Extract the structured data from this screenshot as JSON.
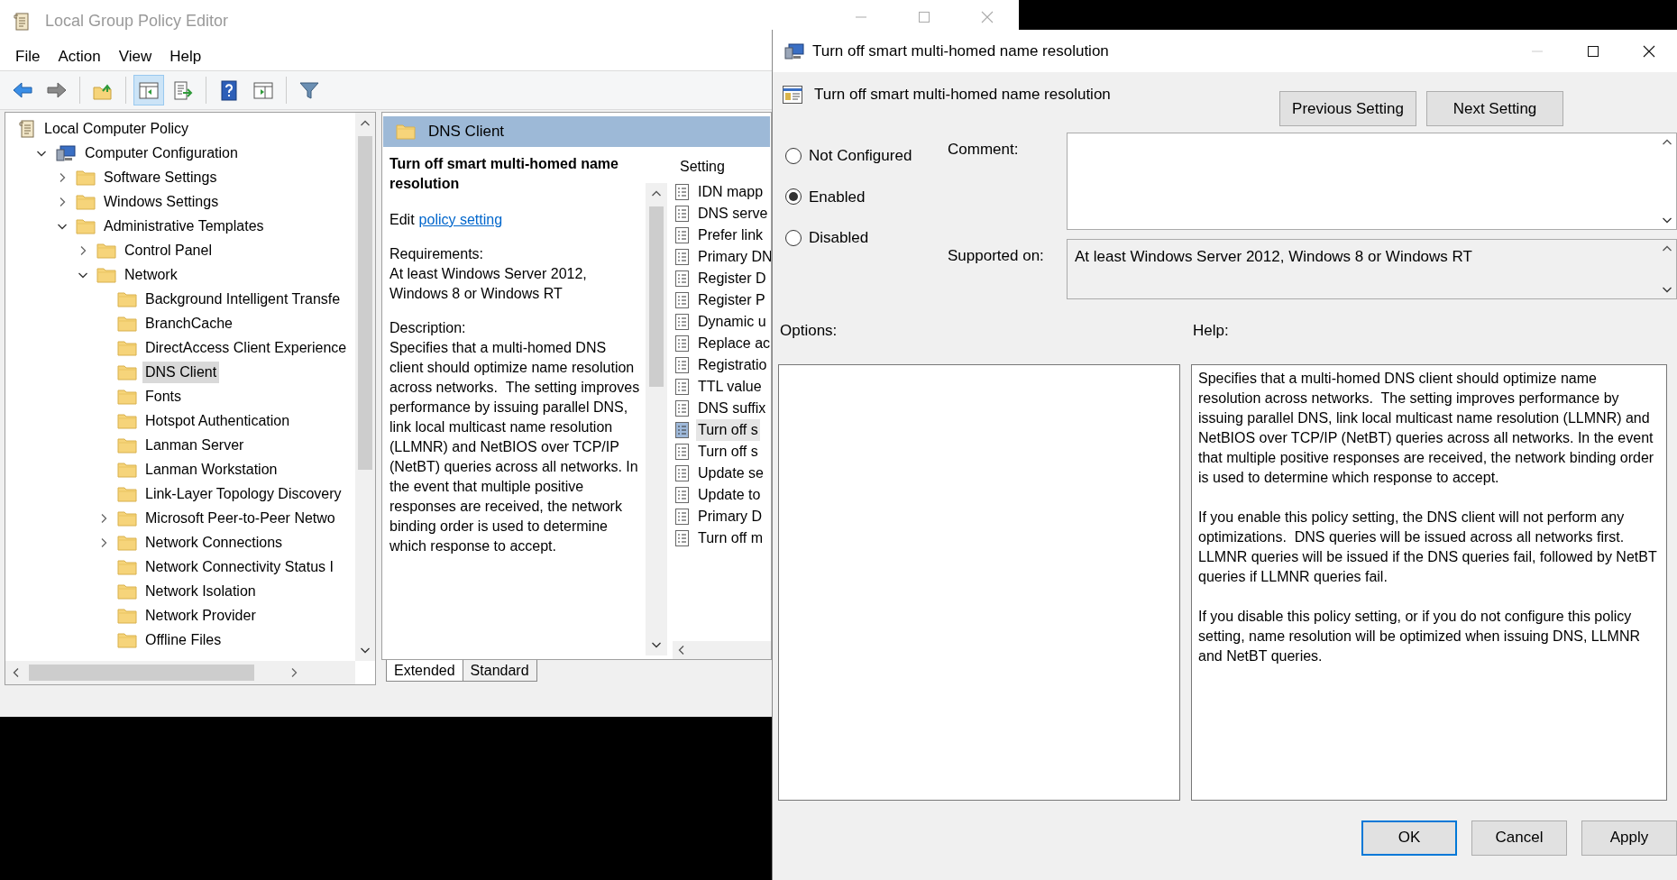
{
  "main_window": {
    "title": "Local Group Policy Editor",
    "menu": [
      "File",
      "Action",
      "View",
      "Help"
    ],
    "toolbar": [
      {
        "pressed": false
      },
      {
        "pressed": false
      },
      {
        "pressed": false
      },
      {
        "pressed": true
      },
      {
        "pressed": false
      },
      {
        "pressed": false
      },
      {
        "pressed": false
      },
      {
        "pressed": false
      }
    ],
    "tree": [
      {
        "label": "Local Computer Policy",
        "kind": "policy",
        "selected": false,
        "children": [
          {
            "label": "Computer Configuration",
            "kind": "computer",
            "expanded": true,
            "selected": false,
            "children": [
              {
                "label": "Software Settings",
                "kind": "folder",
                "expanded": false,
                "selected": false
              },
              {
                "label": "Windows Settings",
                "kind": "folder",
                "expanded": false,
                "selected": false
              },
              {
                "label": "Administrative Templates",
                "kind": "folder",
                "expanded": true,
                "selected": false,
                "children": [
                  {
                    "label": "Control Panel",
                    "kind": "folder",
                    "expanded": false,
                    "selected": false
                  },
                  {
                    "label": "Network",
                    "kind": "folder",
                    "expanded": true,
                    "selected": false,
                    "children": [
                      {
                        "label": "Background Intelligent Transfe",
                        "kind": "folder",
                        "selected": false
                      },
                      {
                        "label": "BranchCache",
                        "kind": "folder",
                        "selected": false
                      },
                      {
                        "label": "DirectAccess Client Experience",
                        "kind": "folder",
                        "selected": false
                      },
                      {
                        "label": "DNS Client",
                        "kind": "folder",
                        "selected": true
                      },
                      {
                        "label": "Fonts",
                        "kind": "folder",
                        "selected": false
                      },
                      {
                        "label": "Hotspot Authentication",
                        "kind": "folder",
                        "selected": false
                      },
                      {
                        "label": "Lanman Server",
                        "kind": "folder",
                        "selected": false
                      },
                      {
                        "label": "Lanman Workstation",
                        "kind": "folder",
                        "selected": false
                      },
                      {
                        "label": "Link-Layer Topology Discovery",
                        "kind": "folder",
                        "selected": false
                      },
                      {
                        "label": "Microsoft Peer-to-Peer Netwo",
                        "kind": "folder",
                        "expanded": false,
                        "selected": false
                      },
                      {
                        "label": "Network Connections",
                        "kind": "folder",
                        "expanded": false,
                        "selected": false
                      },
                      {
                        "label": "Network Connectivity Status I",
                        "kind": "folder",
                        "selected": false
                      },
                      {
                        "label": "Network Isolation",
                        "kind": "folder",
                        "selected": false
                      },
                      {
                        "label": "Network Provider",
                        "kind": "folder",
                        "selected": false
                      },
                      {
                        "label": "Offline Files",
                        "kind": "folder",
                        "selected": false
                      }
                    ]
                  }
                ]
              }
            ]
          }
        ]
      }
    ],
    "panel": {
      "header": "DNS Client",
      "title": "Turn off smart multi-homed name resolution",
      "edit_prefix": "Edit",
      "edit_link": "policy setting",
      "requirements_label": "Requirements:",
      "requirements": "At least Windows Server 2012, Windows 8 or Windows RT",
      "description_label": "Description:",
      "description": "Specifies that a multi-homed DNS client should optimize name resolution across networks.  The setting improves performance by issuing parallel DNS, link local multicast name resolution (LLMNR) and NetBIOS over TCP/IP (NetBT) queries across all networks. In the event that multiple positive responses are received, the network binding order is used to determine which response to accept.",
      "settings_header": "Setting",
      "settings": [
        {
          "label": "IDN mapp",
          "selected": false
        },
        {
          "label": "DNS serve",
          "selected": false
        },
        {
          "label": "Prefer link",
          "selected": false
        },
        {
          "label": "Primary DN",
          "selected": false
        },
        {
          "label": "Register D",
          "selected": false
        },
        {
          "label": "Register P",
          "selected": false
        },
        {
          "label": "Dynamic u",
          "selected": false
        },
        {
          "label": "Replace ac",
          "selected": false
        },
        {
          "label": "Registratio",
          "selected": false
        },
        {
          "label": "TTL value",
          "selected": false
        },
        {
          "label": "DNS suffix",
          "selected": false
        },
        {
          "label": "Turn off s",
          "selected": true
        },
        {
          "label": "Turn off s",
          "selected": false
        },
        {
          "label": "Update se",
          "selected": false
        },
        {
          "label": "Update to",
          "selected": false
        },
        {
          "label": "Primary D",
          "selected": false
        },
        {
          "label": "Turn off m",
          "selected": false
        }
      ],
      "tabs": [
        {
          "label": "Extended",
          "selected": true
        },
        {
          "label": "Standard",
          "selected": false
        }
      ]
    }
  },
  "dialog": {
    "title": "Turn off smart multi-homed name resolution",
    "heading": "Turn off smart multi-homed name resolution",
    "nav_buttons": [
      "Previous Setting",
      "Next Setting"
    ],
    "states": [
      {
        "label": "Not Configured",
        "selected": false
      },
      {
        "label": "Enabled",
        "selected": true
      },
      {
        "label": "Disabled",
        "selected": false
      }
    ],
    "comment_label": "Comment:",
    "supported_label": "Supported on:",
    "supported": "At least Windows Server 2012, Windows 8 or Windows RT",
    "options_label": "Options:",
    "help_label": "Help:",
    "help": [
      "Specifies that a multi-homed DNS client should optimize name resolution across networks.  The setting improves performance by issuing parallel DNS, link local multicast name resolution (LLMNR) and NetBIOS over TCP/IP (NetBT) queries across all networks. In the event that multiple positive responses are received, the network binding order is used to determine which response to accept.",
      "If you enable this policy setting, the DNS client will not perform any optimizations.  DNS queries will be issued across all networks first. LLMNR queries will be issued if the DNS queries fail, followed by NetBT queries if LLMNR queries fail.",
      "If you disable this policy setting, or if you do not configure this policy setting, name resolution will be optimized when issuing DNS, LLMNR and NetBT queries."
    ],
    "buttons": [
      {
        "label": "OK",
        "default": true
      },
      {
        "label": "Cancel",
        "default": false
      },
      {
        "label": "Apply",
        "default": false
      }
    ]
  }
}
